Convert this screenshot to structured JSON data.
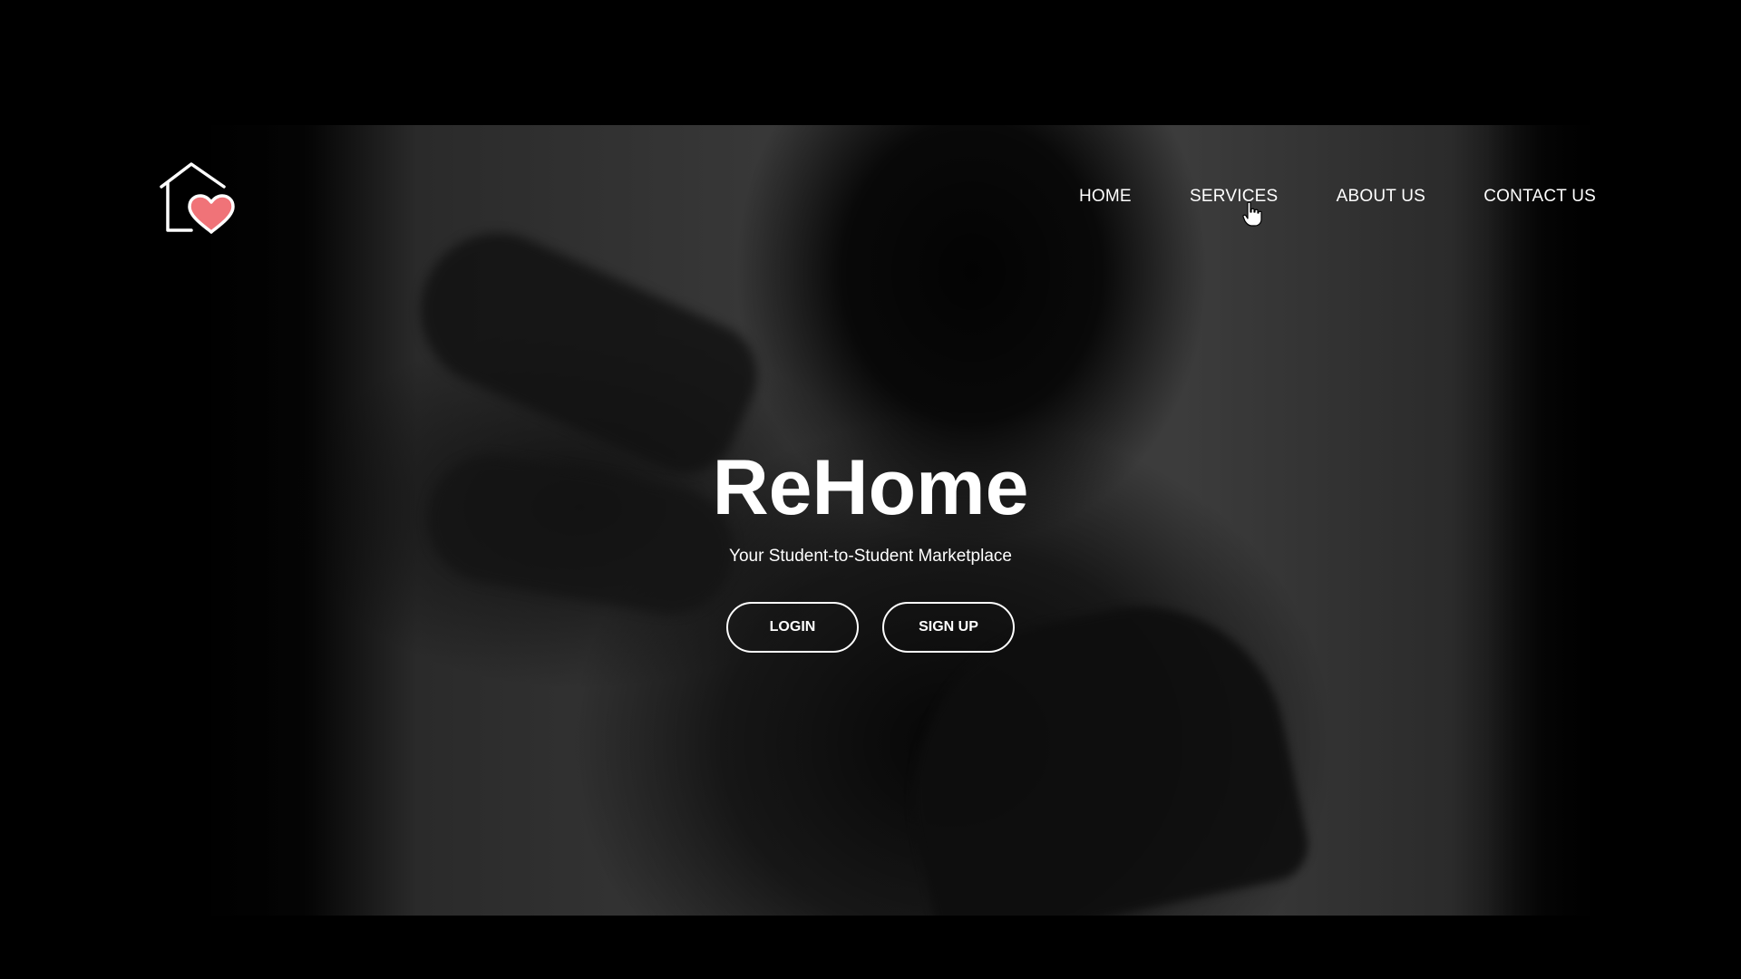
{
  "brand": {
    "logo_icon": "house-heart-icon",
    "heart_color": "#f07378",
    "outline_color": "#ffffff"
  },
  "nav": {
    "items": [
      {
        "label": "HOME"
      },
      {
        "label": "SERVICES"
      },
      {
        "label": "ABOUT US"
      },
      {
        "label": "CONTACT US"
      }
    ]
  },
  "hero": {
    "title": "ReHome",
    "subtitle": "Your Student-to-Student Marketplace",
    "login_label": "LOGIN",
    "signup_label": "SIGN UP"
  },
  "cursor": {
    "icon": "hand-pointer-icon"
  },
  "colors": {
    "background": "#000000",
    "text": "#ffffff"
  }
}
